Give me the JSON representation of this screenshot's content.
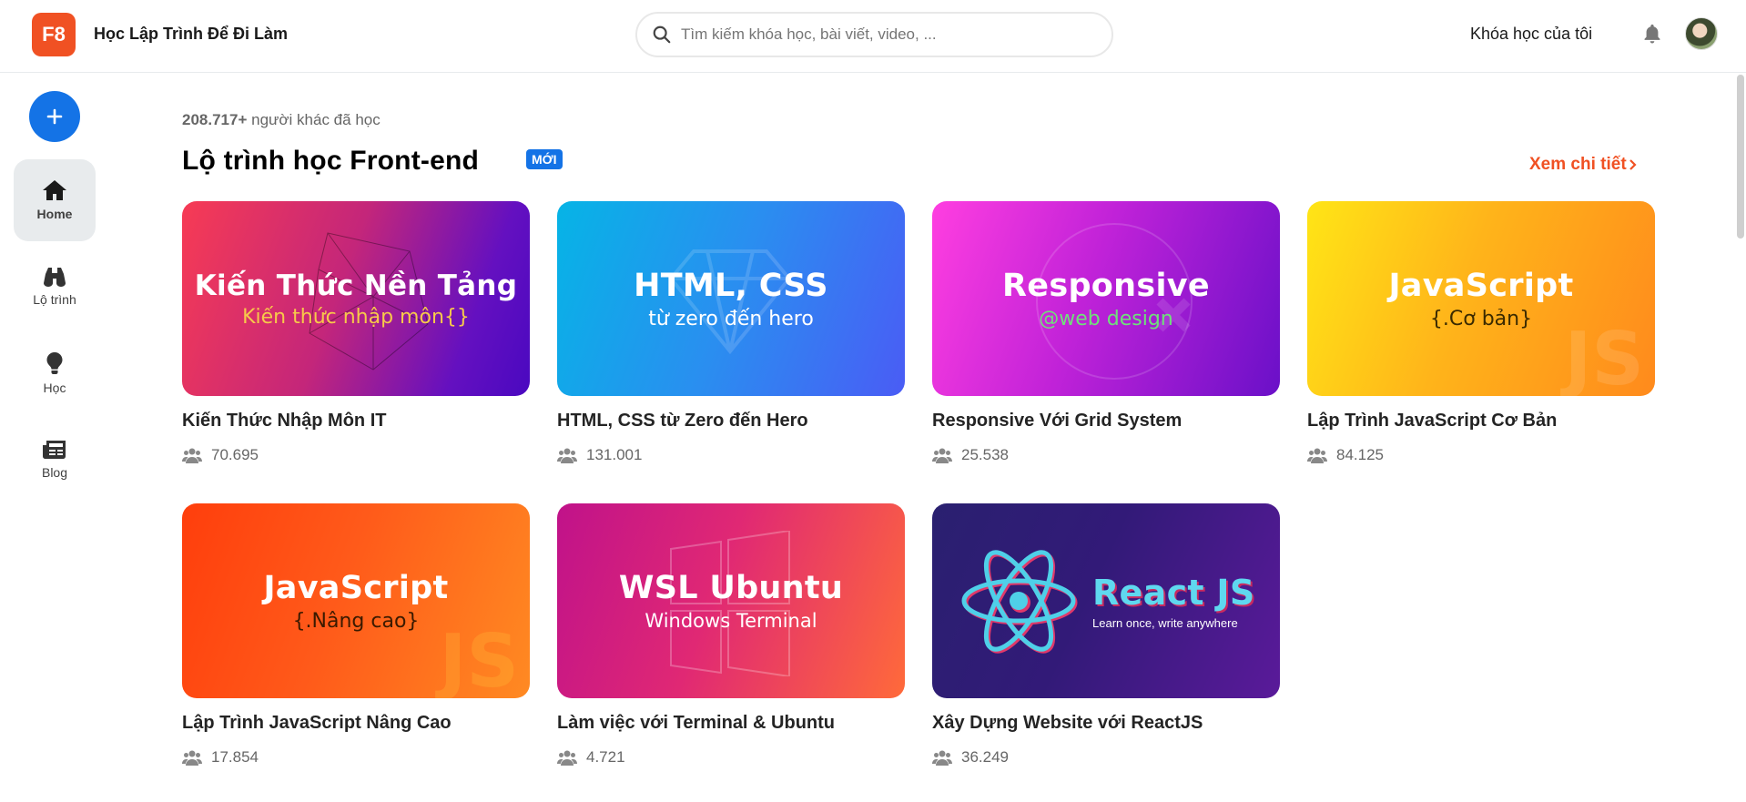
{
  "header": {
    "logo": "F8",
    "brand": "Học Lập Trình Để Đi Làm",
    "search_placeholder": "Tìm kiếm khóa học, bài viết, video, ...",
    "my_courses": "Khóa học của tôi"
  },
  "sidebar": {
    "items": [
      {
        "label": "Home",
        "icon": "home-icon",
        "active": true
      },
      {
        "label": "Lộ trình",
        "icon": "binoculars-icon",
        "active": false
      },
      {
        "label": "Học",
        "icon": "lightbulb-icon",
        "active": false
      },
      {
        "label": "Blog",
        "icon": "newspaper-icon",
        "active": false
      }
    ]
  },
  "main": {
    "learners_count": "208.717+",
    "learners_text": " người khác đã học",
    "section_title": "Lộ trình học Front-end",
    "badge": "MỚI",
    "view_more": "Xem chi tiết",
    "courses": [
      {
        "title": "Kiến Thức Nhập Môn IT",
        "students": "70.695",
        "thumb_title": "Kiến Thức Nền Tảng",
        "thumb_sub": "Kiến thức nhập môn{}",
        "sub_color": "#f7c94a"
      },
      {
        "title": "HTML, CSS từ Zero đến Hero",
        "students": "131.001",
        "thumb_title": "HTML, CSS",
        "thumb_sub": "từ zero đến hero",
        "sub_color": "#ffffff"
      },
      {
        "title": "Responsive Với Grid System",
        "students": "25.538",
        "thumb_title": "Responsive",
        "thumb_sub": "@web design",
        "sub_color": "#6fe07a"
      },
      {
        "title": "Lập Trình JavaScript Cơ Bản",
        "students": "84.125",
        "thumb_title": "JavaScript",
        "thumb_sub": "{.Cơ bản}",
        "sub_color": "#3a2a00"
      },
      {
        "title": "Lập Trình JavaScript Nâng Cao",
        "students": "17.854",
        "thumb_title": "JavaScript",
        "thumb_sub": "{.Nâng cao}",
        "sub_color": "#3a1a00"
      },
      {
        "title": "Làm việc với Terminal & Ubuntu",
        "students": "4.721",
        "thumb_title": "WSL Ubuntu",
        "thumb_sub": "Windows Terminal",
        "sub_color": "#ffffff"
      },
      {
        "title": "Xây Dựng Website với ReactJS",
        "students": "36.249",
        "thumb_title": "React JS",
        "thumb_sub": "Learn once, write anywhere",
        "sub_color": "#ffffff"
      }
    ]
  },
  "colors": {
    "accent": "#f05123",
    "primary": "#1473e6"
  }
}
